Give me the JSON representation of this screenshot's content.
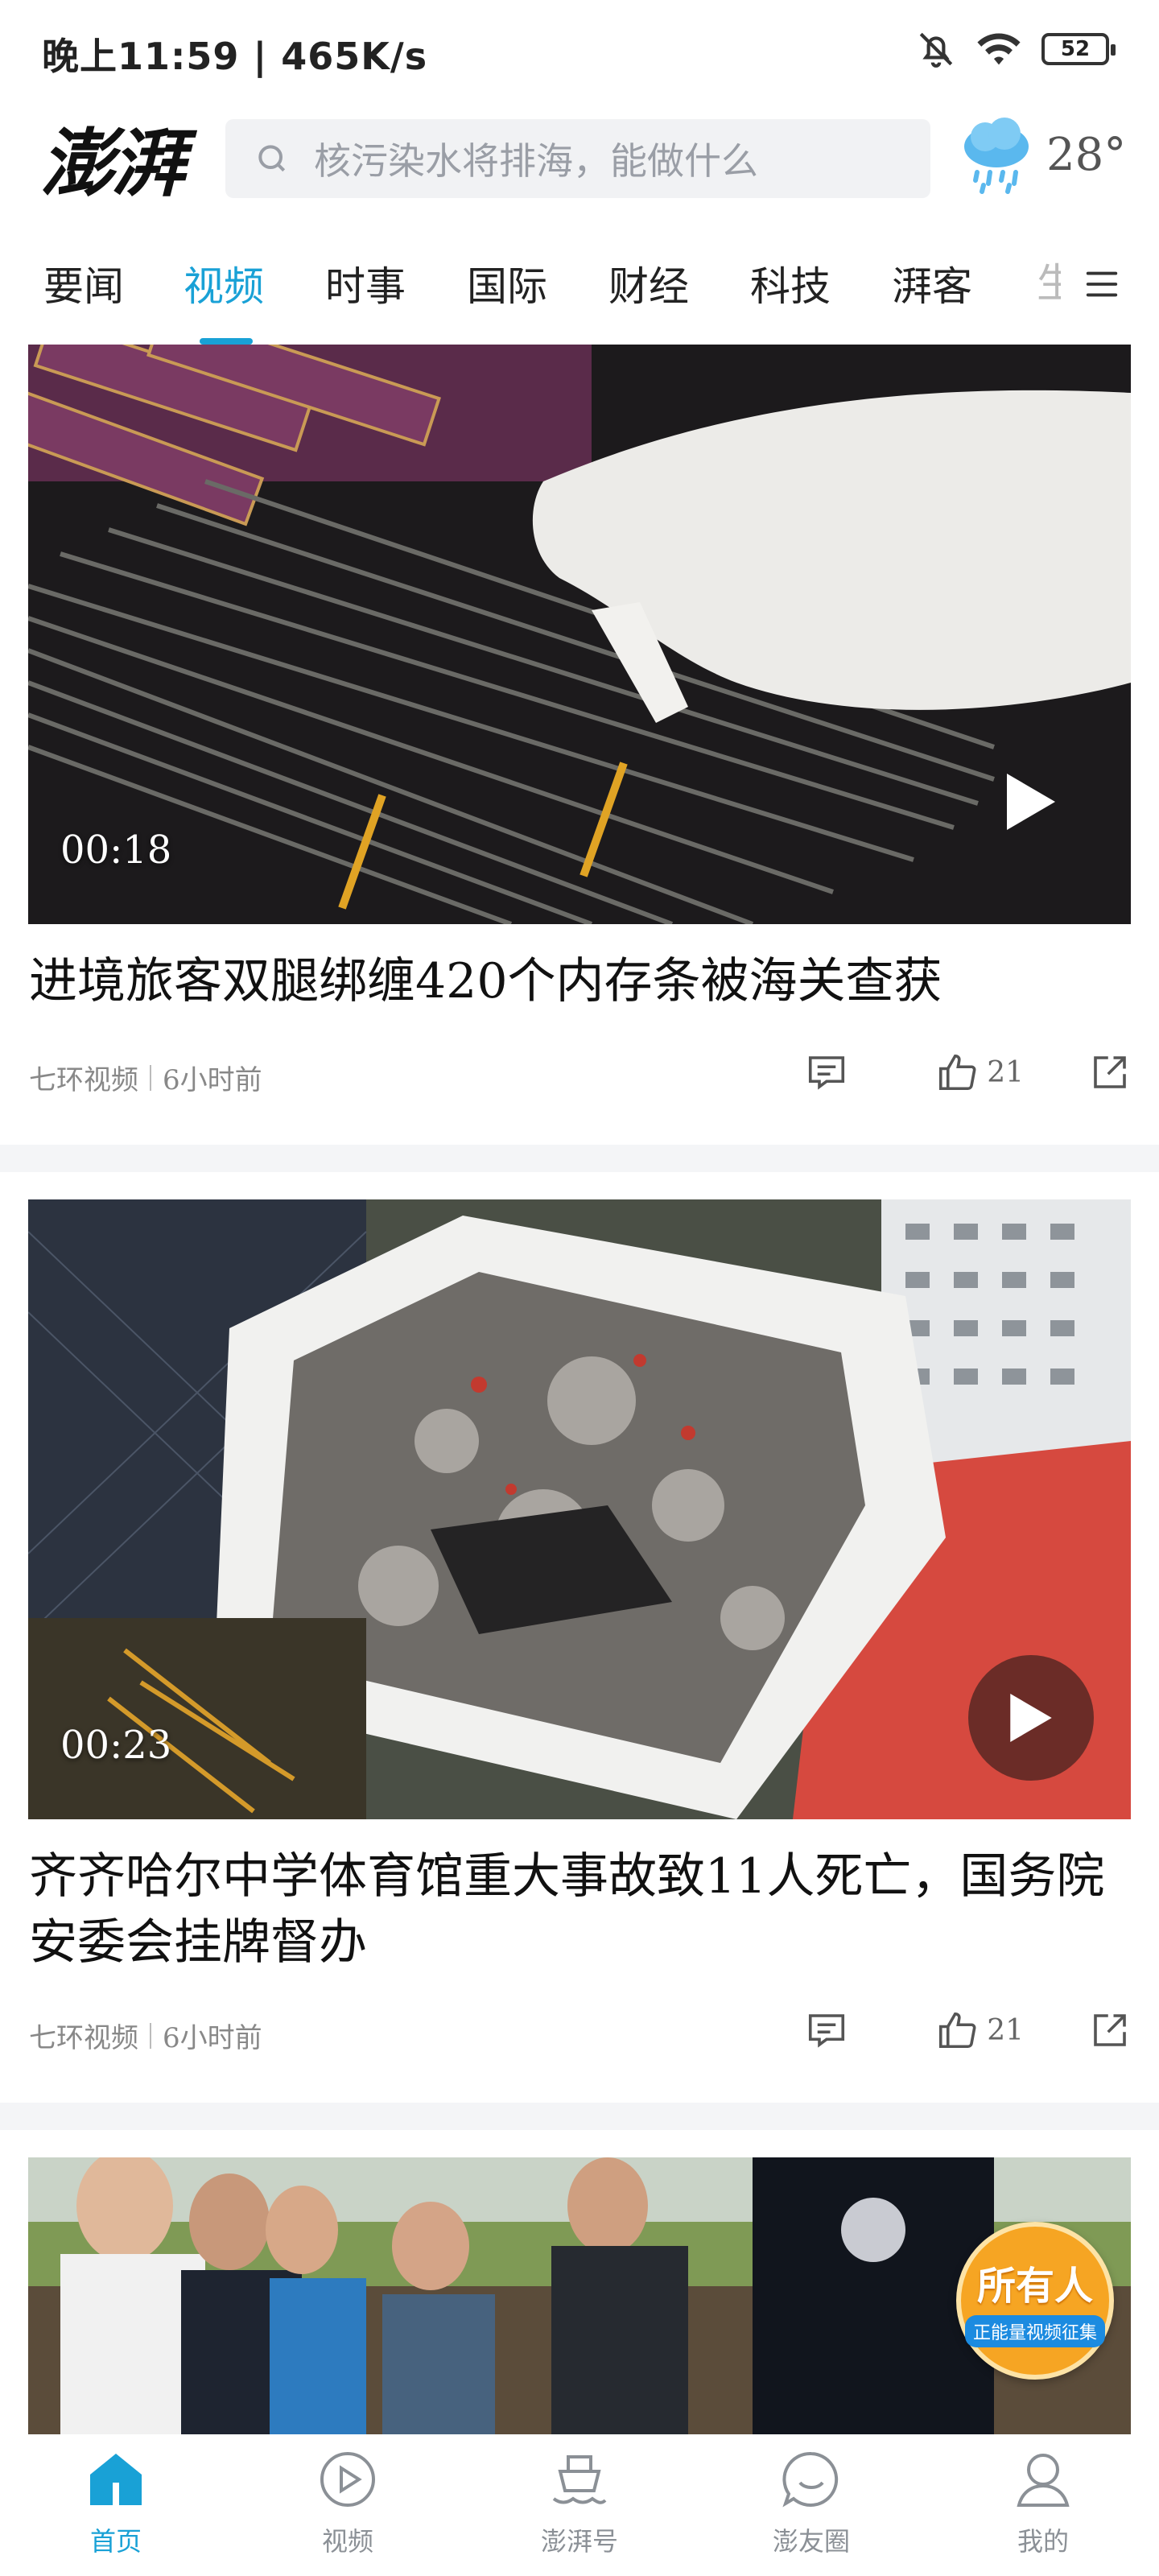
{
  "status_bar": {
    "time_speed": "晚上11:59 | 465K/s",
    "battery": "52",
    "icons": [
      "mute-bell-icon",
      "wifi-icon",
      "battery-icon"
    ]
  },
  "header": {
    "logo_text": "澎湃",
    "search_placeholder": "核污染水将排海，能做什么",
    "weather_icon": "rain-cloud-icon",
    "temperature": "28°"
  },
  "tabs": {
    "items": [
      "要闻",
      "视频",
      "时事",
      "国际",
      "财经",
      "科技",
      "湃客",
      "生"
    ],
    "active_index": 1,
    "menu_icon": "menu-icon"
  },
  "feed": [
    {
      "duration": "00:18",
      "title": "进境旅客双腿绑缠420个内存条被海关查获",
      "source": "七环视频",
      "time": "6小时前",
      "likes": "21"
    },
    {
      "duration": "00:23",
      "title": "齐齐哈尔中学体育馆重大事故致11人死亡，国务院安委会挂牌督办",
      "source": "七环视频",
      "time": "6小时前",
      "likes": "21"
    }
  ],
  "badge": {
    "main": "所有人",
    "sub": "正能量视频征集"
  },
  "bottom_nav": [
    {
      "label": "首页",
      "icon": "home-icon"
    },
    {
      "label": "视频",
      "icon": "video-play-icon"
    },
    {
      "label": "澎湃号",
      "icon": "ship-icon"
    },
    {
      "label": "澎友圈",
      "icon": "chat-circle-icon"
    },
    {
      "label": "我的",
      "icon": "user-icon"
    }
  ],
  "colors": {
    "accent": "#19a1d6",
    "text": "#111111",
    "meta": "#888888",
    "divider": "#f4f5f7"
  }
}
